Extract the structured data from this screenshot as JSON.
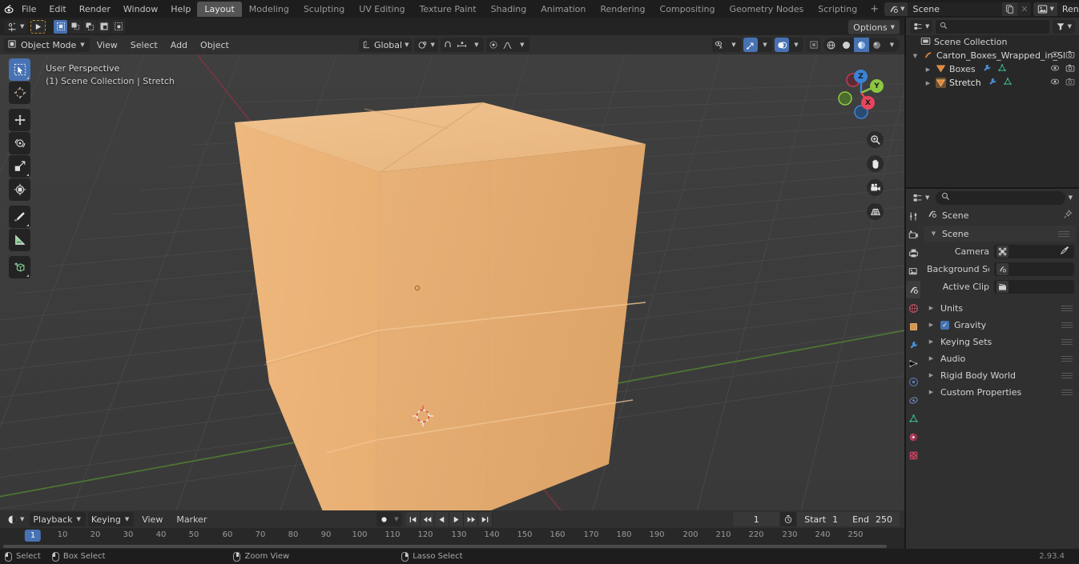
{
  "app": {
    "version": "2.93.4"
  },
  "topbar": {
    "menus": [
      "File",
      "Edit",
      "Render",
      "Window",
      "Help"
    ],
    "workspaces": [
      {
        "label": "Layout",
        "active": true
      },
      {
        "label": "Modeling",
        "active": false
      },
      {
        "label": "Sculpting",
        "active": false
      },
      {
        "label": "UV Editing",
        "active": false
      },
      {
        "label": "Texture Paint",
        "active": false
      },
      {
        "label": "Shading",
        "active": false
      },
      {
        "label": "Animation",
        "active": false
      },
      {
        "label": "Rendering",
        "active": false
      },
      {
        "label": "Compositing",
        "active": false
      },
      {
        "label": "Geometry Nodes",
        "active": false
      },
      {
        "label": "Scripting",
        "active": false
      }
    ],
    "add_workspace": "+",
    "scene_name": "Scene",
    "viewlayer_name": "RenderLayer"
  },
  "viewport_header": {
    "mode": "Object Mode",
    "menus": [
      "View",
      "Select",
      "Add",
      "Object"
    ],
    "transform_orientation": "Global",
    "options_label": "Options"
  },
  "viewport": {
    "perspective_label": "User Perspective",
    "scene_label": "(1) Scene Collection | Stretch",
    "gizmo_axes": [
      {
        "label": "Z",
        "color": "#3b83d6"
      },
      {
        "label": "Y",
        "color": "#8bc741"
      },
      {
        "label": "X",
        "color": "#e8455d"
      }
    ],
    "box_color": "#edb77a",
    "box_top_color": "#ecbb87",
    "box_side_color": "#e2ab71"
  },
  "outliner": {
    "title": "Scene Collection",
    "items": [
      {
        "label": "Carton_Boxes_Wrapped_in_Sl",
        "indent": 0,
        "type": "collection"
      },
      {
        "label": "Boxes",
        "indent": 1,
        "type": "mesh"
      },
      {
        "label": "Stretch",
        "indent": 1,
        "type": "mesh",
        "selected": true
      }
    ]
  },
  "properties": {
    "breadcrumb": "Scene",
    "tabs": [
      "tool-icon",
      "render-icon",
      "output-icon",
      "view-layer-icon",
      "scene-icon",
      "world-icon",
      "object-icon",
      "modifier-icon",
      "particles-icon",
      "physics-icon",
      "constraints-icon",
      "data-icon",
      "material-icon",
      "texture-icon"
    ],
    "active_tab_index": 4,
    "panel_title": "Scene",
    "fields": [
      {
        "label": "Camera",
        "value": "",
        "icon": "camera-icon",
        "eyedropper": true
      },
      {
        "label": "Background Sce...",
        "value": "",
        "icon": "scene-icon",
        "eyedropper": false
      },
      {
        "label": "Active Clip",
        "value": "",
        "icon": "clip-icon",
        "eyedropper": false
      }
    ],
    "panels": [
      {
        "label": "Units",
        "checkbox": null
      },
      {
        "label": "Gravity",
        "checkbox": true
      },
      {
        "label": "Keying Sets",
        "checkbox": null
      },
      {
        "label": "Audio",
        "checkbox": null
      },
      {
        "label": "Rigid Body World",
        "checkbox": null
      },
      {
        "label": "Custom Properties",
        "checkbox": null
      }
    ]
  },
  "timeline": {
    "menus": [
      "Playback",
      "Keying",
      "View",
      "Marker"
    ],
    "current_frame": "1",
    "start_label": "Start",
    "start_value": "1",
    "end_label": "End",
    "end_value": "250",
    "ticks": [
      "1",
      "10",
      "20",
      "30",
      "40",
      "50",
      "60",
      "70",
      "80",
      "90",
      "100",
      "110",
      "120",
      "130",
      "140",
      "150",
      "160",
      "170",
      "180",
      "190",
      "200",
      "210",
      "220",
      "230",
      "240",
      "250"
    ]
  },
  "status": {
    "items": [
      {
        "label": "Select",
        "mouse": "left"
      },
      {
        "label": "Box Select",
        "mouse": "left-drag"
      },
      {
        "label": "Zoom View",
        "mouse": "middle"
      },
      {
        "label": "Lasso Select",
        "mouse": "right"
      }
    ],
    "version": "2.93.4"
  }
}
